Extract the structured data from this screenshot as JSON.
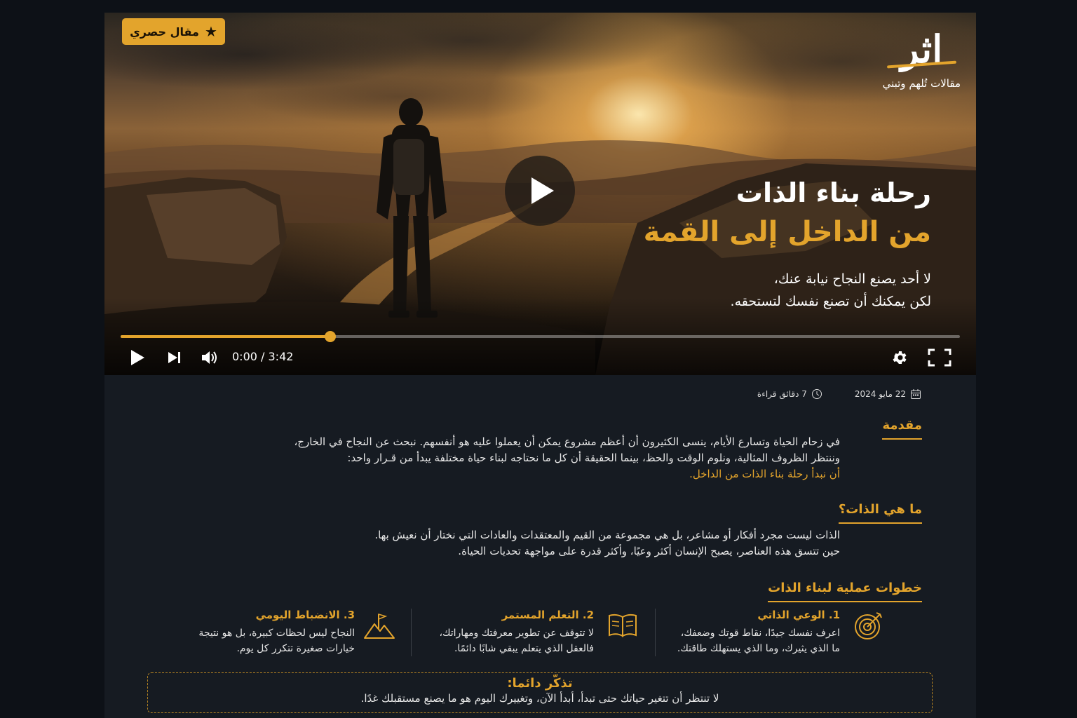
{
  "video": {
    "badge_label": "مقال حصري",
    "logo_text": "اثر",
    "logo_tagline": "مقالات تُلهم وتبني",
    "headline_line1": "رحلة بناء الذات",
    "headline_line2": "من الداخل إلى القمة",
    "subline1": "لا أحد يصنع النجاح نيابة عنك،",
    "subline2": "لكن يمكنك أن تصنع نفسك لتستحقه.",
    "time_display": "0:00 / 3:42",
    "progress_fraction": 0.25
  },
  "meta": {
    "date": "22 مايو 2024",
    "read_time": "7 دقائق قراءة"
  },
  "intro": {
    "title": "مقدمة",
    "line1": "في زحام الحياة وتسارع الأيام، ينسى الكثيرون أن أعظم مشروع يمكن أن يعملوا عليه هو أنفسهم.  نبحث عن النجاح في الخارج،",
    "line2": "وننتظر الظروف المثالية، ونلوم الوقت والحظ، بينما الحقيقة أن كل ما نحتاجه  لبناء حياة مختلفة يبدأ من  قـرار واحد:",
    "line3": "أن نبدأ رحلة بناء الذات من الداخل."
  },
  "what_is": {
    "title": "ما هي الذات؟",
    "line1": "الذات ليست مجرد أفكار أو مشاعر، بل هي مجموعة من القيم والمعتقدات والعادات التي نختار أن نعيش بها.",
    "line2": "حين تتسق هذه العناصر، يصبح الإنسان أكثر وعيًا، وأكثر قدرة على مواجهة تحديات الحياة."
  },
  "steps": {
    "title": "خطوات عملية لبناء الذات",
    "items": [
      {
        "title": "1. الوعي الذاتي",
        "line1": "اعرف نفسك جيدًا، نقاط قوتك وضعفك،",
        "line2": "ما الذي يثيرك، وما الذي يستهلك طاقتك.",
        "icon": "target-icon"
      },
      {
        "title": "2. التعلم المستمر",
        "line1": "لا تتوقف عن تطوير معرفتك ومهاراتك،",
        "line2": "فالعقل الذي يتعلم يبقي شابًا دائمًا.",
        "icon": "book-icon"
      },
      {
        "title": "3. الانضباط اليومي",
        "line1": "النجاح ليس لحظات كبيرة، بل هو نتيجة",
        "line2": "خيارات صغيرة تتكرر كل يوم.",
        "icon": "mountain-flag-icon"
      }
    ]
  },
  "callout": {
    "title": "تذكّر دائما:",
    "text": "لا تنتظر أن تتغير حياتك حتى تبدأ، أبدأ الآن، وتغييرك اليوم هو ما يصنع مستقبلك غدًا."
  },
  "colors": {
    "accent": "#e3a42c",
    "page_bg": "#0d1117",
    "card_bg": "#161b22"
  }
}
